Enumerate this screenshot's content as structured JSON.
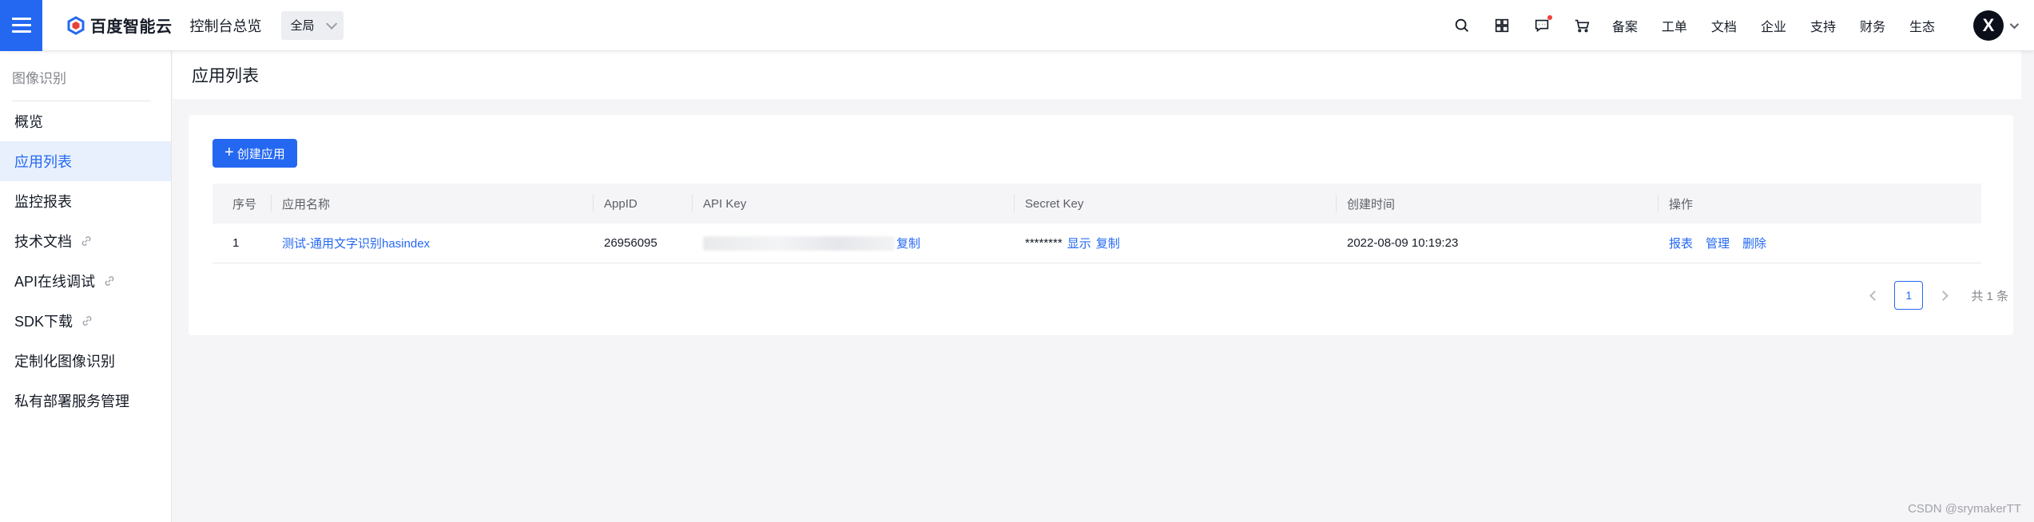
{
  "topbar": {
    "brand": "百度智能云",
    "console_link": "控制台总览",
    "region": "全局",
    "nav": [
      "备案",
      "工单",
      "文档",
      "企业",
      "支持",
      "财务",
      "生态"
    ],
    "avatar_letter": "X",
    "icons": [
      "search-icon",
      "grid-icon",
      "message-icon",
      "cart-icon"
    ]
  },
  "sidebar": {
    "title": "图像识别",
    "items": [
      {
        "label": "概览",
        "external": false
      },
      {
        "label": "应用列表",
        "external": false,
        "active": true
      },
      {
        "label": "监控报表",
        "external": false
      },
      {
        "label": "技术文档",
        "external": true
      },
      {
        "label": "API在线调试",
        "external": true
      },
      {
        "label": "SDK下载",
        "external": true
      },
      {
        "label": "定制化图像识别",
        "external": false
      },
      {
        "label": "私有部署服务管理",
        "external": false
      }
    ]
  },
  "main": {
    "page_title": "应用列表",
    "create_button": "创建应用",
    "table": {
      "headers": [
        "序号",
        "应用名称",
        "AppID",
        "API Key",
        "Secret Key",
        "创建时间",
        "操作"
      ],
      "rows": [
        {
          "index": "1",
          "name": "测试-通用文字识别hasindex",
          "app_id": "26956095",
          "api_key_copy": "复制",
          "secret_key": "********",
          "secret_show": "显示",
          "secret_copy": "复制",
          "created_at": "2022-08-09 10:19:23",
          "actions": [
            "报表",
            "管理",
            "删除"
          ]
        }
      ]
    },
    "pagination": {
      "current_page": "1",
      "total": "共 1 条"
    }
  },
  "watermark": "CSDN @srymakerTT",
  "colors": {
    "accent": "#2468f2",
    "active_bg": "#e8f0fe",
    "page_bg": "#f5f5f8"
  }
}
